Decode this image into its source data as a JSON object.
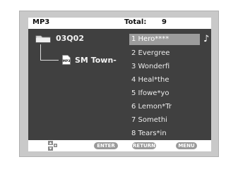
{
  "header": {
    "mode": "MP3",
    "total_label": "Total:",
    "total_count": "9"
  },
  "tree": {
    "folder_label": "03Q02",
    "file_label": "SM Town-"
  },
  "tracks": [
    "1 Hero****",
    "2 Evergree",
    "3 Wonderfi",
    "4 Heal*the",
    "5 Ifowe*yo",
    "6 Lemon*Tr",
    "7 Somethi",
    "8 Tears*in"
  ],
  "selected_track": 0,
  "footer": {
    "enter_label": "ENTER",
    "return_label": "RETURN",
    "menu_label": "MENU"
  },
  "icons": {
    "folder": "folder-icon",
    "mp3": "mp3-file-icon",
    "note": "music-note-icon",
    "nav": "up-down-arrows-icon"
  },
  "colors": {
    "screen_bg": "#404040",
    "selection": "#9c9c9c",
    "bezel": "#c9c9c9"
  }
}
